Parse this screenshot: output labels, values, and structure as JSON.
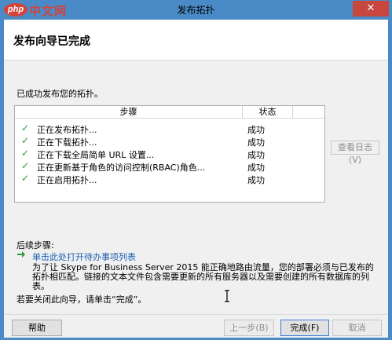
{
  "window": {
    "title": "发布拓扑",
    "close_label": "✕",
    "watermark_badge": "php",
    "watermark_text": "中文网"
  },
  "header": {
    "title": "发布向导已完成"
  },
  "main": {
    "status_text": "已成功发布您的拓扑。",
    "table": {
      "columns": [
        "步骤",
        "状态"
      ],
      "rows": [
        {
          "step": "正在发布拓扑...",
          "status": "成功"
        },
        {
          "step": "正在下载拓扑...",
          "status": "成功"
        },
        {
          "step": "正在下载全局简单 URL 设置...",
          "status": "成功"
        },
        {
          "step": "正在更新基于角色的访问控制(RBAC)角色...",
          "status": "成功"
        },
        {
          "step": "正在启用拓扑...",
          "status": "成功"
        }
      ]
    },
    "view_log_label": "查看日志(V)",
    "next_steps_title": "后续步骤:",
    "todo_link": "单击此处打开待办事项列表",
    "description": "为了让 Skype for Business Server 2015 能正确地路由流量，您的部署必须与已发布的拓扑相匹配。链接的文本文件包含需要更新的所有服务器以及需要创建的所有数据库的列表。",
    "close_hint": "若要关闭此向导，请单击“完成”。"
  },
  "footer": {
    "help_label": "帮助",
    "back_label": "上一步(B)",
    "finish_label": "完成(F)",
    "cancel_label": "取消"
  },
  "colors": {
    "titlebar": "#4a8ac6",
    "close_button": "#c7463e",
    "check": "#2f9b3a",
    "link": "#1a5fb4",
    "arrow": "#2f9b3a"
  }
}
